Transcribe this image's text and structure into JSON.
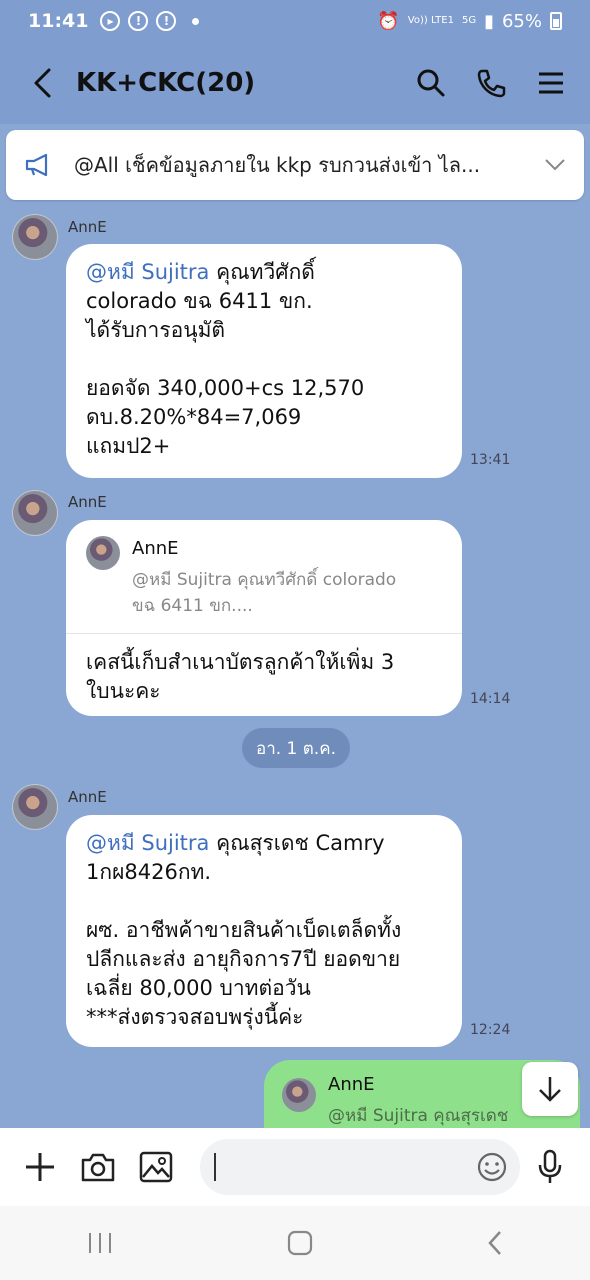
{
  "status": {
    "time": "11:41",
    "net_tag": "Vo)) LTE1",
    "signal_tag": "5G",
    "battery": "65%"
  },
  "header": {
    "title": "KK+CKC(20)",
    "partial_time": "12:24"
  },
  "announcement": {
    "text": "@All  เช็คข้อมูลภายใน kkp รบกวนส่งเข้า ไล..."
  },
  "messages": [
    {
      "sender": "AnnE",
      "mention": "@หมี Sujitra",
      "text_line1_rest": " คุณทวีศักดิ์",
      "lines": [
        "colorado ขฉ 6411 ขก.",
        "ได้รับการอนุมัติ",
        "",
        "ยอดจัด 340,000+cs 12,570",
        "ดบ.8.20%*84=7,069",
        "แถมป2+"
      ],
      "time": "13:41"
    },
    {
      "sender": "AnnE",
      "reply_name": "AnnE",
      "reply_quote_1": "@หมี Sujitra คุณทวีศักดิ์ colorado",
      "reply_quote_2": "ขฉ 6411 ขก....",
      "lines": [
        "เคสนี้เก็บสำเนาบัตรลูกค้าให้เพิ่ม 3",
        "ใบนะคะ"
      ],
      "time": "14:14"
    },
    {
      "sender": "AnnE",
      "mention": "@หมี Sujitra",
      "text_line1_rest": " คุณสุรเดช Camry",
      "lines": [
        "1กผ8426กท.",
        "",
        "ผซ. อาชีพค้าขายสินค้าเบ็ดเตล็ดทั้ง",
        "ปลีกและส่ง อายุกิจการ7ปี ยอดขาย",
        "เฉลี่ย 80,000 บาทต่อวัน",
        "***ส่งตรวจสอบพรุ่งนี้ค่ะ"
      ],
      "time": "12:24"
    }
  ],
  "date_divider": "อา. 1 ต.ค.",
  "my_reply": {
    "name": "AnnE",
    "quote": "@หมี Sujitra คุณสุรเดช"
  },
  "colors": {
    "background": "#8aa6d3",
    "header": "#7f9dce",
    "mention": "#3f6fbf",
    "my_bubble": "#8fe08a"
  }
}
